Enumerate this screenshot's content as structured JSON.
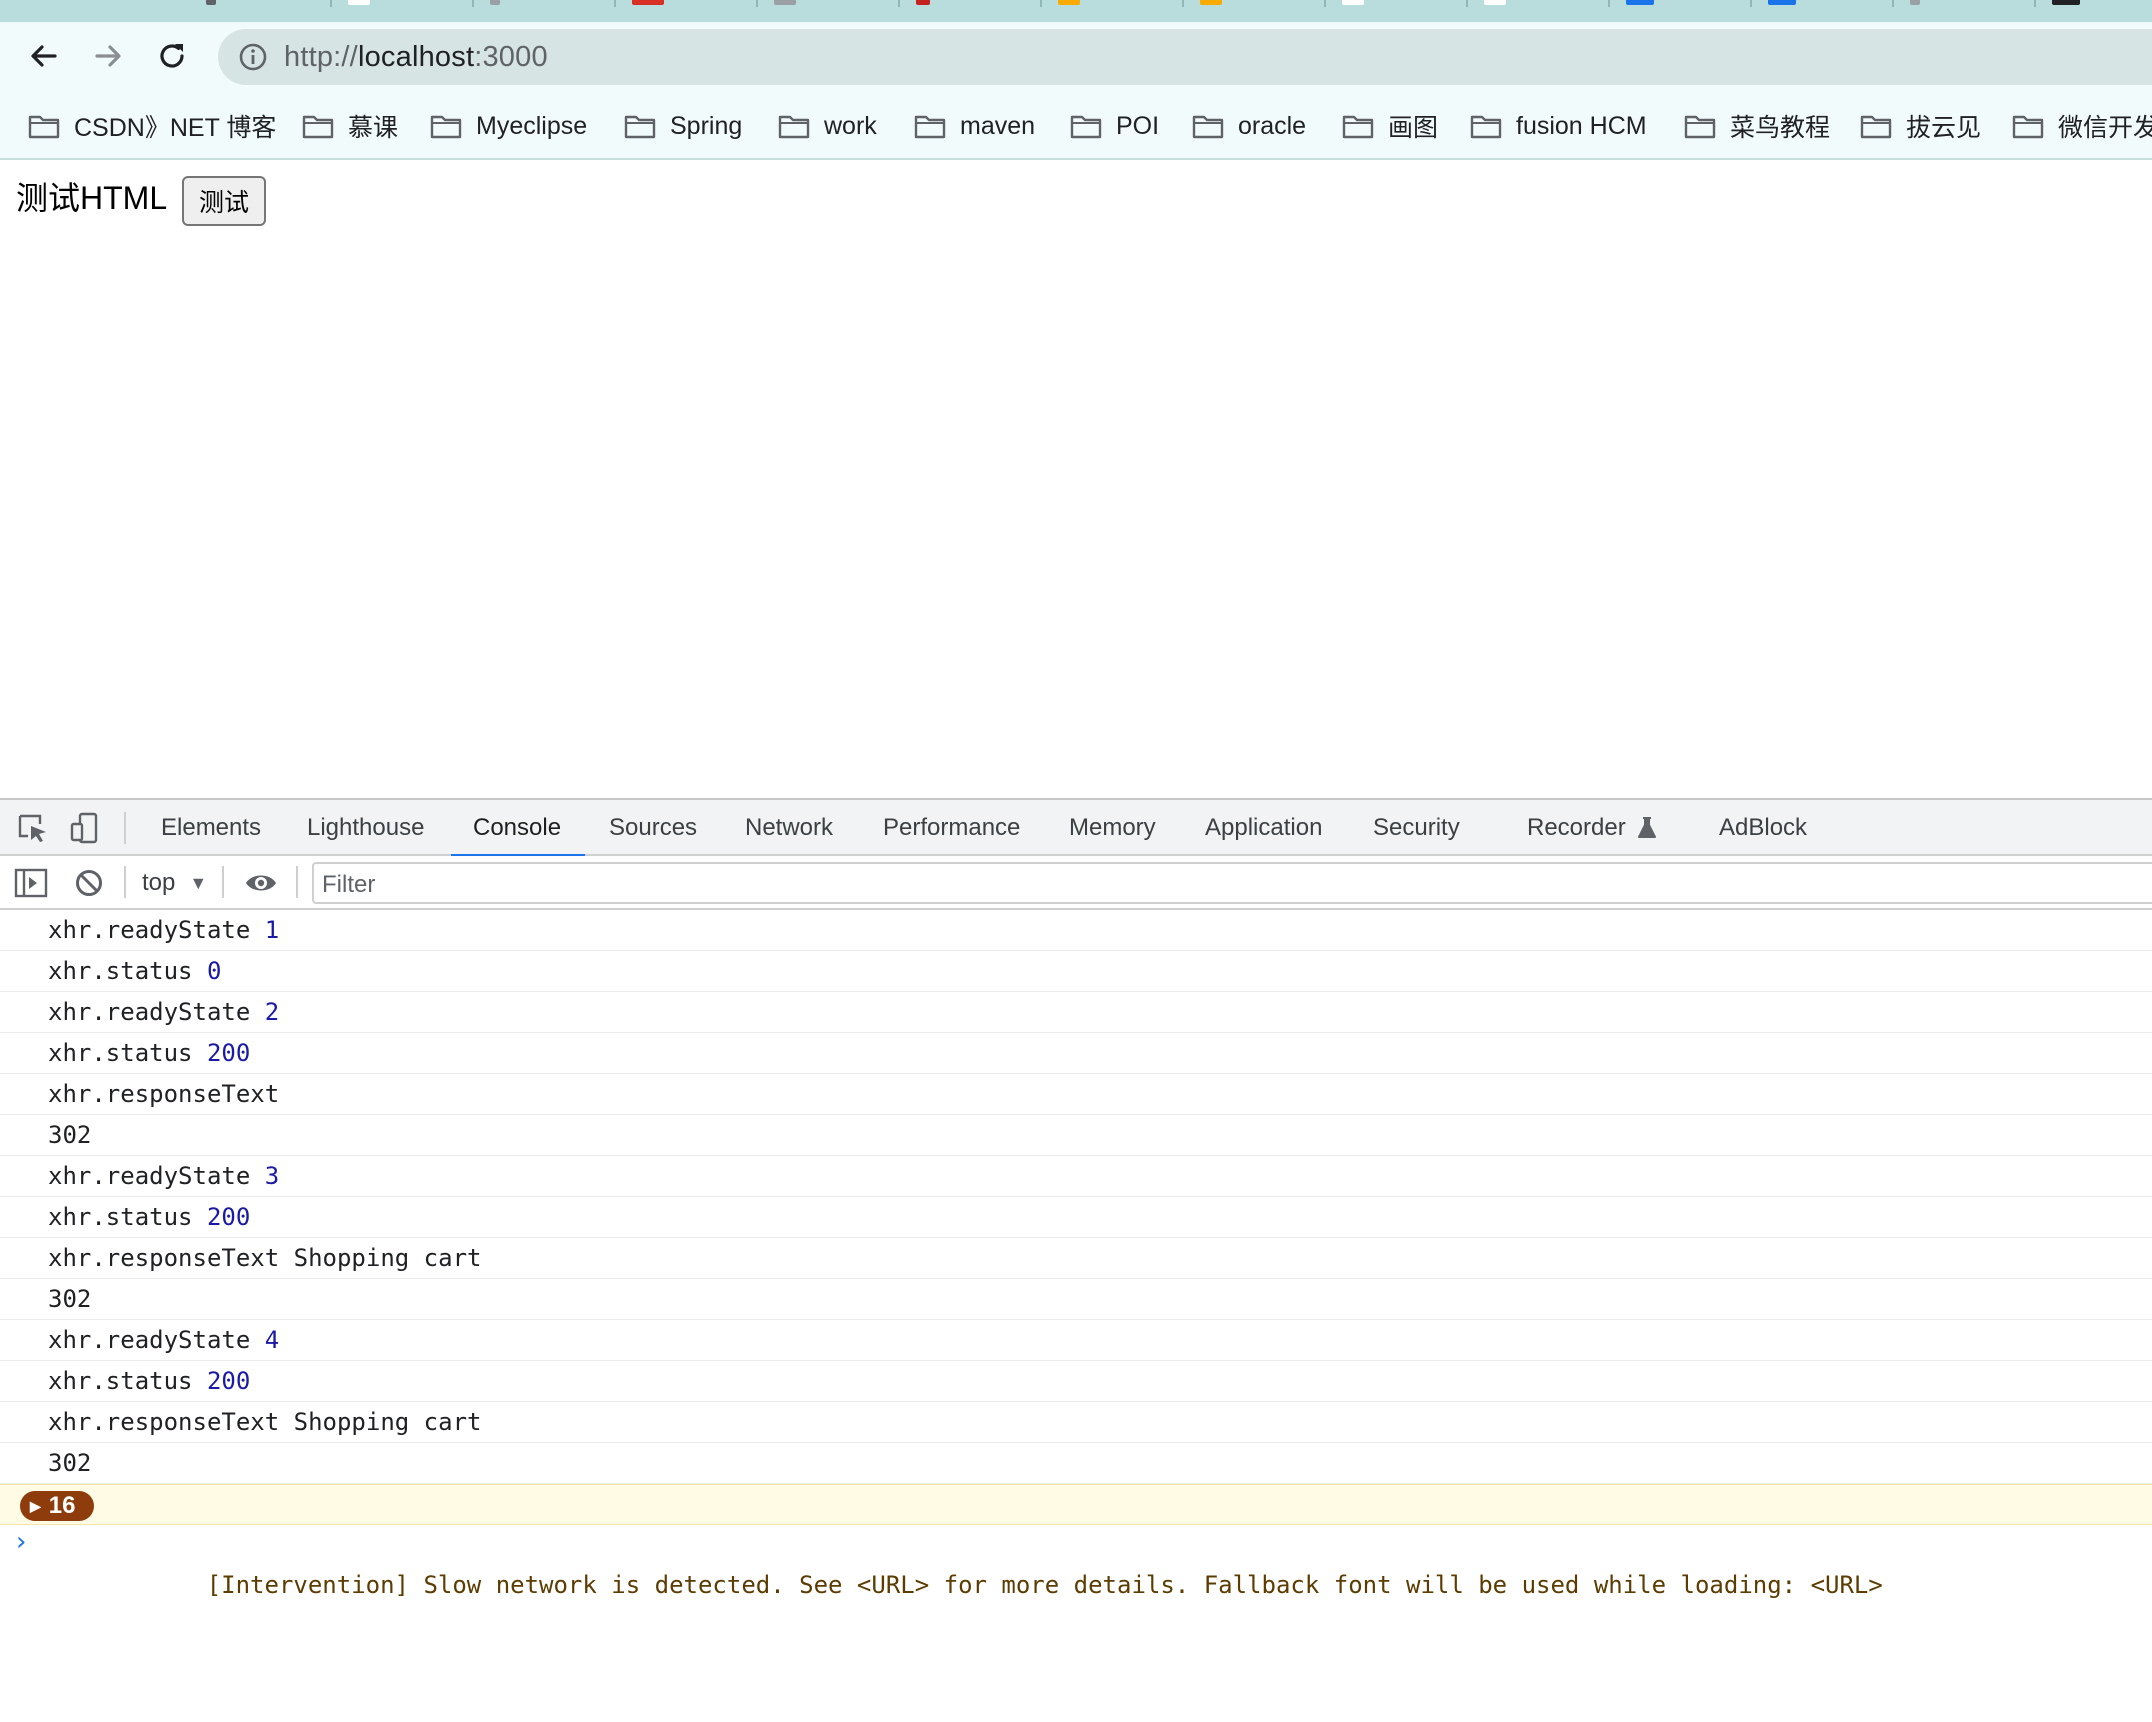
{
  "browser": {
    "url_scheme": "http://",
    "url_host": "localhost",
    "url_port": ":3000",
    "tab_favicon_colors": [
      "#5f6368",
      "#ffffff",
      "#9aa0a6",
      "#d93025",
      "#9aa0a6",
      "#c5221f",
      "#f9ab00",
      "#f9ab00",
      "#ffffff",
      "#ffffff",
      "#1a73e8",
      "#1a73e8",
      "#9aa0a6",
      "#202124"
    ]
  },
  "bookmarks": [
    {
      "label": "CSDN》NET 博客"
    },
    {
      "label": "慕课"
    },
    {
      "label": "Myeclipse"
    },
    {
      "label": "Spring"
    },
    {
      "label": "work"
    },
    {
      "label": "maven"
    },
    {
      "label": "POI"
    },
    {
      "label": "oracle"
    },
    {
      "label": "画图"
    },
    {
      "label": "fusion HCM"
    },
    {
      "label": "菜鸟教程"
    },
    {
      "label": "拔云见"
    },
    {
      "label": "微信开发"
    }
  ],
  "page": {
    "label": "测试HTML",
    "button_label": "测试"
  },
  "devtools": {
    "tabs": [
      {
        "label": "Elements"
      },
      {
        "label": "Lighthouse"
      },
      {
        "label": "Console",
        "active": true
      },
      {
        "label": "Sources"
      },
      {
        "label": "Network"
      },
      {
        "label": "Performance"
      },
      {
        "label": "Memory"
      },
      {
        "label": "Application"
      },
      {
        "label": "Security"
      },
      {
        "label": "Recorder"
      },
      {
        "label": "AdBlock"
      }
    ],
    "context": "top",
    "filter_placeholder": "Filter",
    "console_lines": [
      {
        "text": "xhr.readyState ",
        "value": "1"
      },
      {
        "text": "xhr.status ",
        "value": "0"
      },
      {
        "text": "xhr.readyState ",
        "value": "2"
      },
      {
        "text": "xhr.status ",
        "value": "200"
      },
      {
        "text": "xhr.responseText",
        "value": ""
      },
      {
        "text": "302",
        "value": ""
      },
      {
        "text": "xhr.readyState ",
        "value": "3"
      },
      {
        "text": "xhr.status ",
        "value": "200"
      },
      {
        "text": "xhr.responseText Shopping cart",
        "value": ""
      },
      {
        "text": "302",
        "value": ""
      },
      {
        "text": "xhr.readyState ",
        "value": "4"
      },
      {
        "text": "xhr.status ",
        "value": "200"
      },
      {
        "text": "xhr.responseText Shopping cart",
        "value": ""
      },
      {
        "text": "302",
        "value": ""
      }
    ],
    "warning": {
      "count": "16",
      "text": "[Intervention] Slow network is detected. See <URL> for more details. Fallback font will be used while loading: <URL>"
    },
    "prompt_symbol": "›"
  },
  "colors": {
    "accent": "#1a73e8",
    "console_number": "#1a1aa6",
    "warning_badge": "#8e3c0b",
    "warning_bg": "#fffbe5"
  }
}
